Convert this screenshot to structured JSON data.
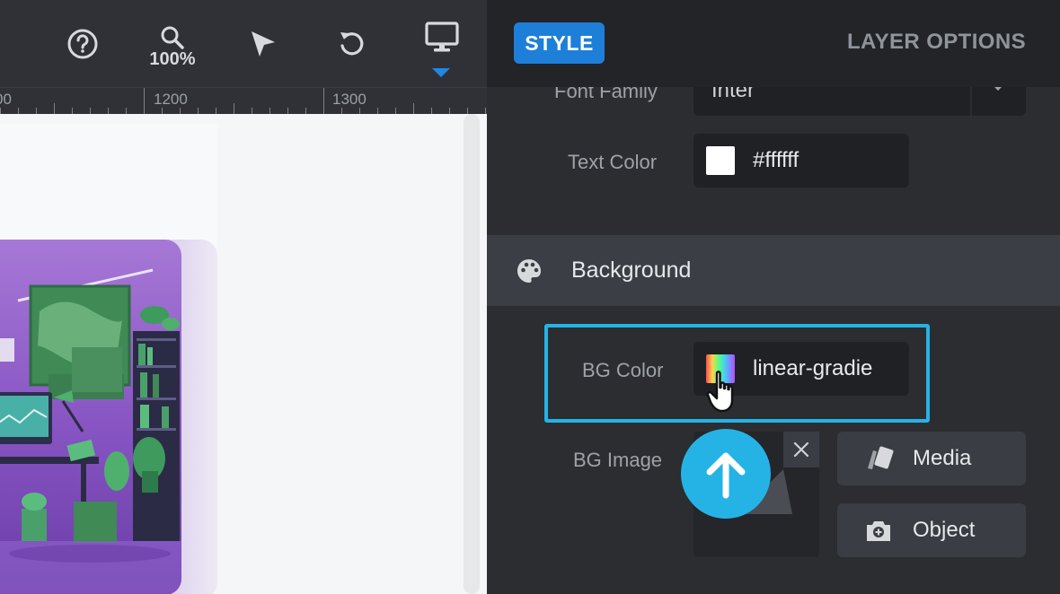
{
  "toolbar": {
    "help_icon": "help-circle-icon",
    "zoom_icon": "zoom-icon",
    "zoom_level": "100%",
    "select_icon": "cursor-arrow-icon",
    "undo_icon": "undo-icon",
    "device_icon": "desktop-monitor-icon"
  },
  "ruler": {
    "labels": [
      "00",
      "1200",
      "1300"
    ]
  },
  "panel": {
    "tabs": {
      "style": "STYLE",
      "layer_options": "LAYER OPTIONS"
    },
    "font_family": {
      "label": "Font Family",
      "value": "Inter"
    },
    "text_color": {
      "label": "Text Color",
      "value": "#ffffff"
    },
    "background_section": {
      "title": "Background",
      "icon": "palette-icon"
    },
    "bg_color": {
      "label": "BG Color",
      "value": "linear-gradie"
    },
    "bg_image": {
      "label": "BG Image",
      "media_button": "Media",
      "object_button": "Object"
    }
  },
  "colors": {
    "accent_blue": "#1e7fd9",
    "highlight_cyan": "#25b3e6",
    "panel_bg": "#2b2d31"
  }
}
